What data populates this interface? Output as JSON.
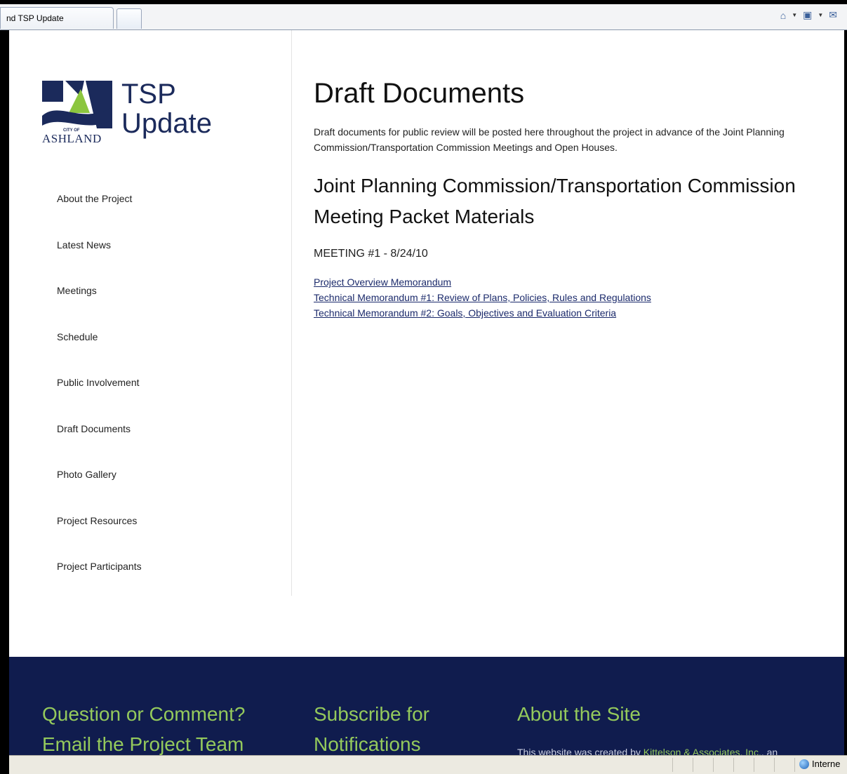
{
  "browser": {
    "tab_title": "nd TSP Update",
    "status_zone": "Interne"
  },
  "site": {
    "logo": {
      "city_small": "CITY OF",
      "city": "ASHLAND"
    },
    "brand_line1": "TSP",
    "brand_line2": "Update"
  },
  "nav": [
    "About the Project",
    "Latest News",
    "Meetings",
    "Schedule",
    "Public Involvement",
    "Draft Documents",
    "Photo Gallery",
    "Project Resources",
    "Project Participants"
  ],
  "main": {
    "title": "Draft Documents",
    "intro": "Draft documents for public review will be posted here throughout the project in advance of the Joint Planning Commission/Transportation Commission Meetings and Open Houses.",
    "section_title": "Joint Planning Commission/Transportation Commission Meeting Packet Materials",
    "meeting_label": "MEETING #1 - 8/24/10",
    "documents": [
      "Project Overview Memorandum",
      "Technical Memorandum #1: Review of Plans, Policies, Rules and Regulations",
      "Technical Memorandum #2: Goals, Objectives and Evaluation Criteria"
    ]
  },
  "footer": {
    "col1_line1": "Question or Comment?",
    "col1_line2": "Email the Project Team",
    "col2_line1": "Subscribe for",
    "col2_line2": "Notifications",
    "col3_title": "About the Site",
    "col3_text_prefix": "This website was created by ",
    "col3_link": "Kittelson & Associates, Inc.",
    "col3_text_suffix": ", an"
  },
  "colors": {
    "navy": "#101c4e",
    "accent_green": "#94c95c",
    "link": "#1b2a6b"
  }
}
